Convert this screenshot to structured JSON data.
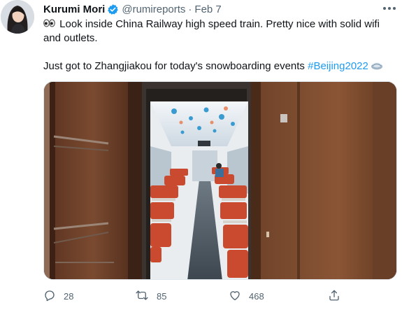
{
  "tweet": {
    "author_name": "Kurumi Mori",
    "handle": "@rumireports",
    "separator": "·",
    "date": "Feb 7",
    "text_line1": "Look inside China Railway high speed train. Pretty nice with solid wifi and outlets.",
    "text_line2_prefix": "Just got to Zhangjiakou for today's snowboarding events",
    "hashtag": "#Beijing2022",
    "icons": {
      "eyes_emoji": "eyes-emoji-icon",
      "flag_emoji": "beijing2022-hashflag-icon",
      "verified": "verified-badge-icon",
      "more": "more-options-icon"
    },
    "accent_color": "#1d9bf0"
  },
  "actions": {
    "reply": {
      "icon": "reply-icon",
      "count": "28"
    },
    "retweet": {
      "icon": "retweet-icon",
      "count": "85"
    },
    "like": {
      "icon": "like-icon",
      "count": "468"
    },
    "share": {
      "icon": "share-icon"
    }
  }
}
